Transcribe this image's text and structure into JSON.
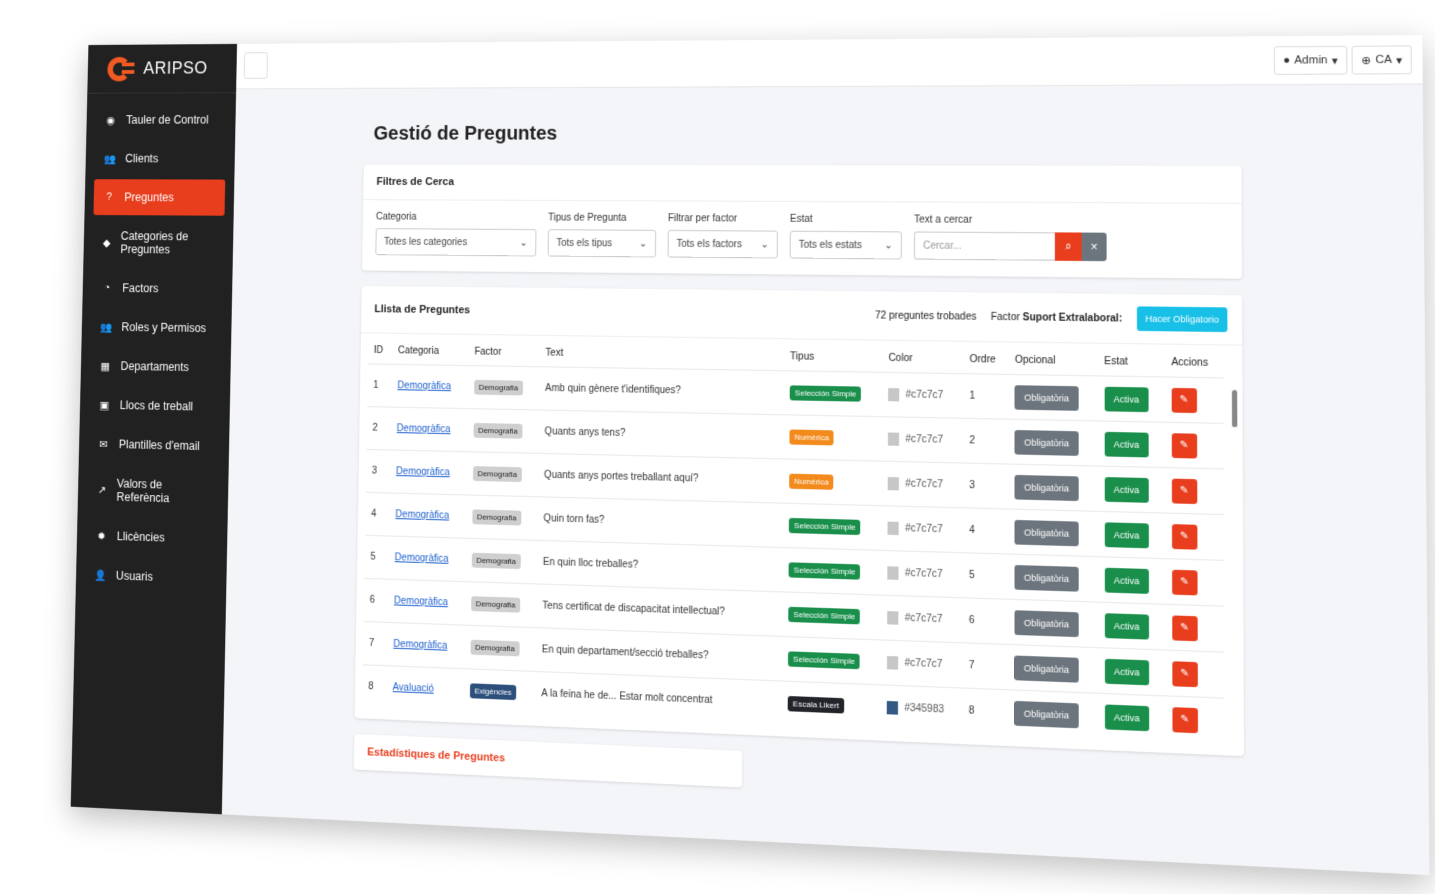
{
  "brand": {
    "name": "ARIPSO"
  },
  "sidebar": {
    "items": [
      {
        "label": "Tauler de Control",
        "icon": "dashboard-icon",
        "glyph": "◉",
        "active": false
      },
      {
        "label": "Clients",
        "icon": "users-icon",
        "glyph": "👥",
        "active": false
      },
      {
        "label": "Preguntes",
        "icon": "question-icon",
        "glyph": "?",
        "active": true
      },
      {
        "label": "Categories de Preguntes",
        "icon": "tag-icon",
        "glyph": "◆",
        "active": false
      },
      {
        "label": "Factors",
        "icon": "chart-pie-icon",
        "glyph": "◔",
        "active": false
      },
      {
        "label": "Roles y Permisos",
        "icon": "user-shield-icon",
        "glyph": "👥",
        "active": false
      },
      {
        "label": "Departaments",
        "icon": "building-icon",
        "glyph": "▦",
        "active": false
      },
      {
        "label": "Llocs de treball",
        "icon": "briefcase-icon",
        "glyph": "▣",
        "active": false
      },
      {
        "label": "Plantilles d'email",
        "icon": "envelope-icon",
        "glyph": "✉",
        "active": false
      },
      {
        "label": "Valors de Referència",
        "icon": "line-chart-icon",
        "glyph": "↗",
        "active": false
      },
      {
        "label": "Llicències",
        "icon": "certificate-icon",
        "glyph": "✹",
        "active": false
      },
      {
        "label": "Usuaris",
        "icon": "user-icon",
        "glyph": "👤",
        "active": false
      }
    ]
  },
  "topbar": {
    "menu_glyph": "≡",
    "admin_label": "Admin",
    "lang_label": "CA"
  },
  "page": {
    "title": "Gestió de Preguntes"
  },
  "filters": {
    "header": "Filtres de Cerca",
    "categoria": {
      "label": "Categoria",
      "value": "Totes les categories"
    },
    "tipus": {
      "label": "Tipus de Pregunta",
      "value": "Tots els tipus"
    },
    "factor": {
      "label": "Filtrar per factor",
      "value": "Tots els factors"
    },
    "estat": {
      "label": "Estat",
      "value": "Tots els estats"
    },
    "text": {
      "label": "Text a cercar",
      "placeholder": "Cercar..."
    }
  },
  "list": {
    "header": "Llista de Preguntes",
    "count_text": "72 preguntes trobades",
    "factor_prefix": "Factor",
    "factor_name": "Suport Extralaboral:",
    "action_button": "Hacer Obligatorio",
    "columns": [
      "ID",
      "Categoria",
      "Factor",
      "Text",
      "Tipus",
      "Color",
      "Ordre",
      "Opcional",
      "Estat",
      "Accions"
    ],
    "rows": [
      {
        "id": "1",
        "categoria": "Demogràfica",
        "factor": "Demografia",
        "factor_style": "grey",
        "text": "Amb quin gènere t'identifiques?",
        "tipus": "Selección Simple",
        "tipus_style": "green",
        "color": "#c7c7c7",
        "ordre": "1",
        "opcional": "Obligatòria",
        "estat": "Activa"
      },
      {
        "id": "2",
        "categoria": "Demogràfica",
        "factor": "Demografia",
        "factor_style": "grey",
        "text": "Quants anys tens?",
        "tipus": "Numérica",
        "tipus_style": "orange",
        "color": "#c7c7c7",
        "ordre": "2",
        "opcional": "Obligatòria",
        "estat": "Activa"
      },
      {
        "id": "3",
        "categoria": "Demogràfica",
        "factor": "Demografia",
        "factor_style": "grey",
        "text": "Quants anys portes treballant aquí?",
        "tipus": "Numérica",
        "tipus_style": "orange",
        "color": "#c7c7c7",
        "ordre": "3",
        "opcional": "Obligatòria",
        "estat": "Activa"
      },
      {
        "id": "4",
        "categoria": "Demogràfica",
        "factor": "Demografia",
        "factor_style": "grey",
        "text": "Quin torn fas?",
        "tipus": "Selección Simple",
        "tipus_style": "green",
        "color": "#c7c7c7",
        "ordre": "4",
        "opcional": "Obligatòria",
        "estat": "Activa"
      },
      {
        "id": "5",
        "categoria": "Demogràfica",
        "factor": "Demografia",
        "factor_style": "grey",
        "text": "En quin lloc treballes?",
        "tipus": "Selección Simple",
        "tipus_style": "green",
        "color": "#c7c7c7",
        "ordre": "5",
        "opcional": "Obligatòria",
        "estat": "Activa"
      },
      {
        "id": "6",
        "categoria": "Demogràfica",
        "factor": "Demografia",
        "factor_style": "grey",
        "text": "Tens certificat de discapacitat intellectual?",
        "tipus": "Selección Simple",
        "tipus_style": "green",
        "color": "#c7c7c7",
        "ordre": "6",
        "opcional": "Obligatòria",
        "estat": "Activa"
      },
      {
        "id": "7",
        "categoria": "Demogràfica",
        "factor": "Demografia",
        "factor_style": "grey",
        "text": "En quin departament/secció treballes?",
        "tipus": "Selección Simple",
        "tipus_style": "green",
        "color": "#c7c7c7",
        "ordre": "7",
        "opcional": "Obligatòria",
        "estat": "Activa"
      },
      {
        "id": "8",
        "categoria": "Avaluació",
        "factor": "Exigències",
        "factor_style": "navy",
        "text": "A la feina he de... Estar molt concentrat",
        "tipus": "Escala Likert",
        "tipus_style": "dark",
        "color": "#345983",
        "ordre": "8",
        "opcional": "Obligatòria",
        "estat": "Activa"
      }
    ]
  },
  "stats": {
    "title": "Estadístiques de Preguntes"
  },
  "ui": {
    "edit_glyph": "✎",
    "search_glyph": "⌕",
    "clear_glyph": "×",
    "chevron": "⌄",
    "caret": "▾",
    "user_glyph": "●",
    "globe_glyph": "⊕"
  }
}
